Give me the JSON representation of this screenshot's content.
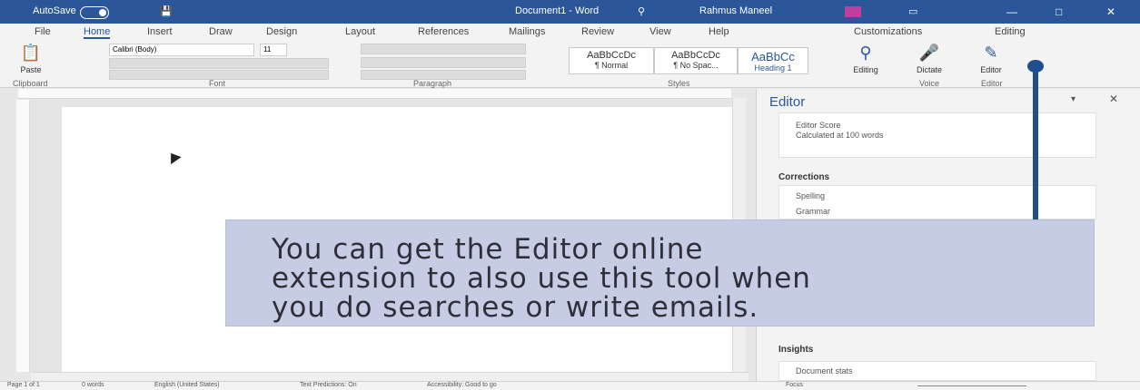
{
  "titlebar": {
    "autosave_label": "AutoSave",
    "toggle_state": "Off",
    "doc_title": "Document1 - Word",
    "user_name": "Rahmus Maneel"
  },
  "menu": {
    "tabs": [
      "File",
      "Home",
      "Insert",
      "Draw",
      "Design",
      "Layout",
      "References",
      "Mailings",
      "Review",
      "View",
      "Help"
    ],
    "active_tab": "Home",
    "right_items": [
      "Customizations",
      "Editing"
    ]
  },
  "ribbon": {
    "font_name": "Calibri (Body)",
    "font_size": "11",
    "styles": [
      {
        "preview": "AaBbCcDc",
        "name": "¶ Normal"
      },
      {
        "preview": "AaBbCcDc",
        "name": "¶ No Spac..."
      },
      {
        "preview": "AaBbCc",
        "name": "Heading 1"
      }
    ],
    "buttons": {
      "paste": "Paste",
      "editing": "Editing",
      "dictate": "Dictate",
      "editor": "Editor"
    },
    "groups": [
      "Clipboard",
      "Font",
      "Paragraph",
      "Styles",
      "Voice",
      "Editor"
    ]
  },
  "editor_pane": {
    "title": "Editor",
    "score_line1": "Editor Score",
    "score_line2": "Calculated at 100 words",
    "corrections_heading": "Corrections",
    "correction_items": [
      "Spelling",
      "Grammar"
    ],
    "insights_heading": "Insights",
    "insights_item": "Document stats"
  },
  "statusbar": {
    "page": "Page 1 of 1",
    "words": "0 words",
    "language": "English (United States)",
    "predictions": "Text Predictions: On",
    "accessibility": "Accessibility: Good to go",
    "focus": "Focus"
  },
  "callout": {
    "text": "You can get the Editor online\nextension to also use this tool when\nyou do searches or write emails."
  },
  "colors": {
    "accent": "#2b579a",
    "callout_bg": "#c6cce4",
    "pointer": "#1f4e8c"
  }
}
